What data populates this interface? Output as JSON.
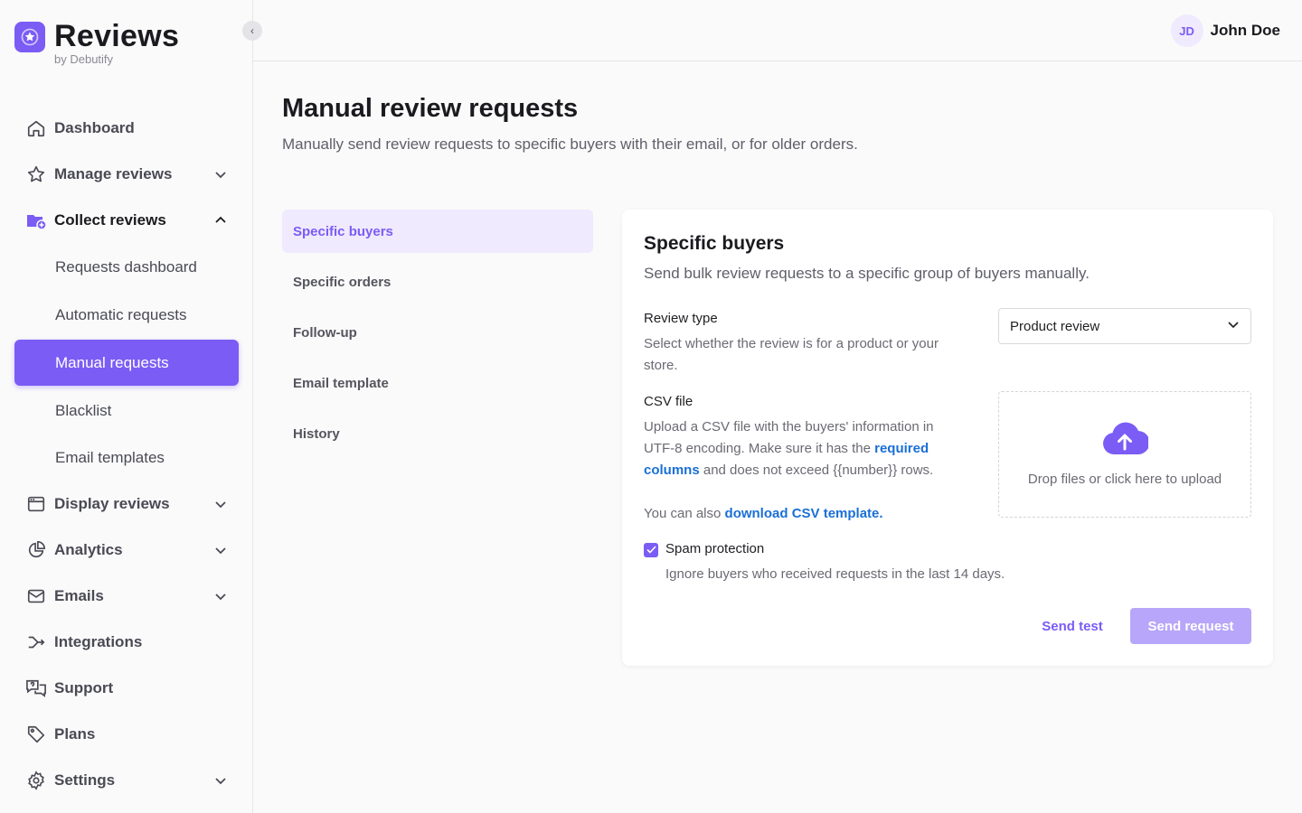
{
  "brand": {
    "name": "Reviews",
    "subtitle": "by Debutify"
  },
  "user": {
    "initials": "JD",
    "name": "John Doe"
  },
  "sidebar": {
    "items": [
      {
        "label": "Dashboard",
        "icon": "home-icon"
      },
      {
        "label": "Manage reviews",
        "icon": "star-icon"
      },
      {
        "label": "Collect reviews",
        "icon": "collect-icon"
      },
      {
        "label": "Display reviews",
        "icon": "browser-window-icon"
      },
      {
        "label": "Analytics",
        "icon": "pie-chart-icon"
      },
      {
        "label": "Emails",
        "icon": "mail-icon"
      },
      {
        "label": "Integrations",
        "icon": "integrations-icon"
      },
      {
        "label": "Support",
        "icon": "support-chat-icon"
      },
      {
        "label": "Plans",
        "icon": "tag-icon"
      },
      {
        "label": "Settings",
        "icon": "gear-icon"
      }
    ],
    "collect_sub": [
      {
        "label": "Requests dashboard"
      },
      {
        "label": "Automatic requests"
      },
      {
        "label": "Manual requests"
      },
      {
        "label": "Blacklist"
      },
      {
        "label": "Email templates"
      }
    ]
  },
  "page": {
    "title": "Manual review requests",
    "description": "Manually send review requests to specific buyers with their email, or for older orders."
  },
  "subnav": [
    {
      "label": "Specific buyers"
    },
    {
      "label": "Specific orders"
    },
    {
      "label": "Follow-up"
    },
    {
      "label": "Email template"
    },
    {
      "label": "History"
    }
  ],
  "card": {
    "title": "Specific buyers",
    "description": "Send bulk review requests to a specific group of buyers manually.",
    "review_type": {
      "label": "Review type",
      "help": "Select whether the review is for a product or your store.",
      "value": "Product review"
    },
    "csv": {
      "label": "CSV file",
      "help_1": "Upload a CSV file with the buyers' information in UTF-8 encoding. Make sure it has the ",
      "help_link": "required columns",
      "help_2": " and does not exceed {{number}} rows.",
      "also_prefix": "You can also ",
      "also_link": "download CSV template.",
      "drop_text": "Drop files or click here to upload"
    },
    "spam": {
      "label": "Spam protection",
      "help": "Ignore buyers who received requests in the last 14 days.",
      "checked": true
    },
    "send_test": "Send test",
    "send_request": "Send request"
  },
  "colors": {
    "accent": "#7b5cf5",
    "accent_light": "#efeafd",
    "link": "#1a6fd6",
    "disabled_primary": "#b7a6f9"
  }
}
